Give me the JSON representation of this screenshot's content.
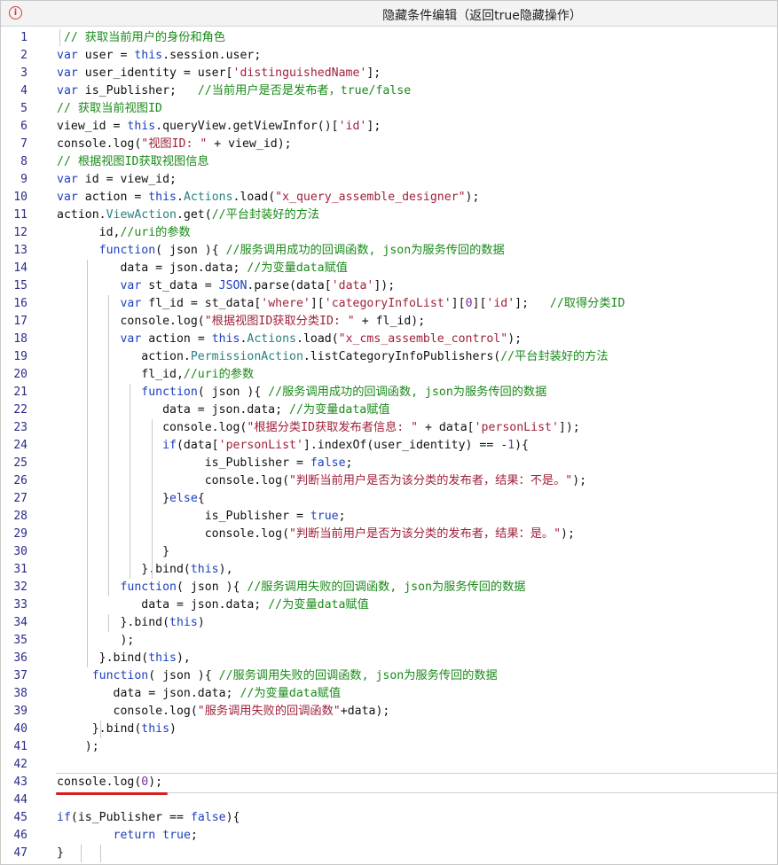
{
  "window": {
    "title": "隐藏条件编辑（返回true隐藏操作）",
    "icon": "info-icon"
  },
  "code": [
    {
      "n": "1",
      "t": " // 获取当前用户的身份和角色"
    },
    {
      "n": "2",
      "t": "var user = this.session.user;"
    },
    {
      "n": "3",
      "t": "var user_identity = user['distinguishedName'];"
    },
    {
      "n": "4",
      "t": "var is_Publisher;   //当前用户是否是发布者，true/false"
    },
    {
      "n": "5",
      "t": "// 获取当前视图ID"
    },
    {
      "n": "6",
      "t": "view_id = this.queryView.getViewInfor()['id'];"
    },
    {
      "n": "7",
      "t": "console.log(\"视图ID: \" + view_id);"
    },
    {
      "n": "8",
      "t": "// 根据视图ID获取视图信息"
    },
    {
      "n": "9",
      "t": "var id = view_id;"
    },
    {
      "n": "10",
      "t": "var action = this.Actions.load(\"x_query_assemble_designer\");"
    },
    {
      "n": "11",
      "t": "action.ViewAction.get(//平台封装好的方法"
    },
    {
      "n": "12",
      "t": "      id,//uri的参数"
    },
    {
      "n": "13",
      "t": "      function( json ){ //服务调用成功的回调函数, json为服务传回的数据"
    },
    {
      "n": "14",
      "t": "         data = json.data; //为变量data赋值"
    },
    {
      "n": "15",
      "t": "         var st_data = JSON.parse(data['data']);"
    },
    {
      "n": "16",
      "t": "         var fl_id = st_data['where']['categoryInfoList'][0]['id'];   //取得分类ID"
    },
    {
      "n": "17",
      "t": "         console.log(\"根据视图ID获取分类ID: \" + fl_id);"
    },
    {
      "n": "18",
      "t": "         var action = this.Actions.load(\"x_cms_assemble_control\");"
    },
    {
      "n": "19",
      "t": "            action.PermissionAction.listCategoryInfoPublishers(//平台封装好的方法"
    },
    {
      "n": "20",
      "t": "            fl_id,//uri的参数"
    },
    {
      "n": "21",
      "t": "            function( json ){ //服务调用成功的回调函数, json为服务传回的数据"
    },
    {
      "n": "22",
      "t": "               data = json.data; //为变量data赋值"
    },
    {
      "n": "23",
      "t": "               console.log(\"根据分类ID获取发布者信息: \" + data['personList']);"
    },
    {
      "n": "24",
      "t": "               if(data['personList'].indexOf(user_identity) == -1){"
    },
    {
      "n": "25",
      "t": "                     is_Publisher = false;"
    },
    {
      "n": "26",
      "t": "                     console.log(\"判断当前用户是否为该分类的发布者，结果：不是。\");"
    },
    {
      "n": "27",
      "t": "               }else{"
    },
    {
      "n": "28",
      "t": "                     is_Publisher = true;"
    },
    {
      "n": "29",
      "t": "                     console.log(\"判断当前用户是否为该分类的发布者，结果：是。\");"
    },
    {
      "n": "30",
      "t": "               }"
    },
    {
      "n": "31",
      "t": "            }.bind(this),"
    },
    {
      "n": "32",
      "t": "         function( json ){ //服务调用失败的回调函数, json为服务传回的数据"
    },
    {
      "n": "33",
      "t": "            data = json.data; //为变量data赋值"
    },
    {
      "n": "34",
      "t": "         }.bind(this)"
    },
    {
      "n": "35",
      "t": "         );"
    },
    {
      "n": "36",
      "t": "      }.bind(this),"
    },
    {
      "n": "37",
      "t": "     function( json ){ //服务调用失败的回调函数, json为服务传回的数据"
    },
    {
      "n": "38",
      "t": "        data = json.data; //为变量data赋值"
    },
    {
      "n": "39",
      "t": "        console.log(\"服务调用失败的回调函数\"+data);"
    },
    {
      "n": "40",
      "t": "     }.bind(this)"
    },
    {
      "n": "41",
      "t": "    );"
    },
    {
      "n": "42",
      "t": ""
    },
    {
      "n": "43",
      "t": "console.log(0);"
    },
    {
      "n": "44",
      "t": ""
    },
    {
      "n": "45",
      "t": "if(is_Publisher == false){"
    },
    {
      "n": "46",
      "t": "        return true;"
    },
    {
      "n": "47",
      "t": "}"
    }
  ],
  "colors": {
    "keyword": "#1d3fbf",
    "string": "#a0223b",
    "comment": "#1a8a1a",
    "object": "#2a7f7f",
    "underline": "#d61f1f"
  }
}
